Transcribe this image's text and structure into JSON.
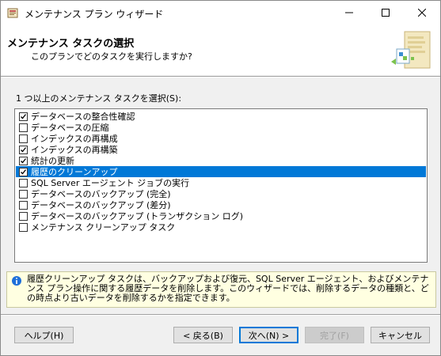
{
  "window": {
    "title": "メンテナンス プラン ウィザード"
  },
  "header": {
    "title": "メンテナンス タスクの選択",
    "subtitle": "このプランでどのタスクを実行しますか?"
  },
  "list": {
    "label": "1 つ以上のメンテナンス タスクを選択(S):",
    "items": [
      {
        "label": "データベースの整合性確認",
        "checked": true,
        "selected": false
      },
      {
        "label": "データベースの圧縮",
        "checked": false,
        "selected": false
      },
      {
        "label": "インデックスの再構成",
        "checked": false,
        "selected": false
      },
      {
        "label": "インデックスの再構築",
        "checked": true,
        "selected": false
      },
      {
        "label": "統計の更新",
        "checked": true,
        "selected": false
      },
      {
        "label": "履歴のクリーンアップ",
        "checked": true,
        "selected": true
      },
      {
        "label": "SQL Server エージェント ジョブの実行",
        "checked": false,
        "selected": false
      },
      {
        "label": "データベースのバックアップ (完全)",
        "checked": false,
        "selected": false
      },
      {
        "label": "データベースのバックアップ (差分)",
        "checked": false,
        "selected": false
      },
      {
        "label": "データベースのバックアップ (トランザクション ログ)",
        "checked": false,
        "selected": false
      },
      {
        "label": "メンテナンス クリーンアップ タスク",
        "checked": false,
        "selected": false
      }
    ]
  },
  "description": {
    "text": "履歴クリーンアップ タスクは、バックアップおよび復元、SQL Server エージェント、およびメンテナンス プラン操作に関する履歴データを削除します。このウィザードでは、削除するデータの種類と、どの時点より古いデータを削除するかを指定できます。"
  },
  "buttons": {
    "help": "ヘルプ(H)",
    "back": "< 戻る(B)",
    "next": "次へ(N) >",
    "finish": "完了(F)",
    "cancel": "キャンセル"
  },
  "colors": {
    "selection": "#0078d7",
    "info_background": "#ffffe1"
  }
}
